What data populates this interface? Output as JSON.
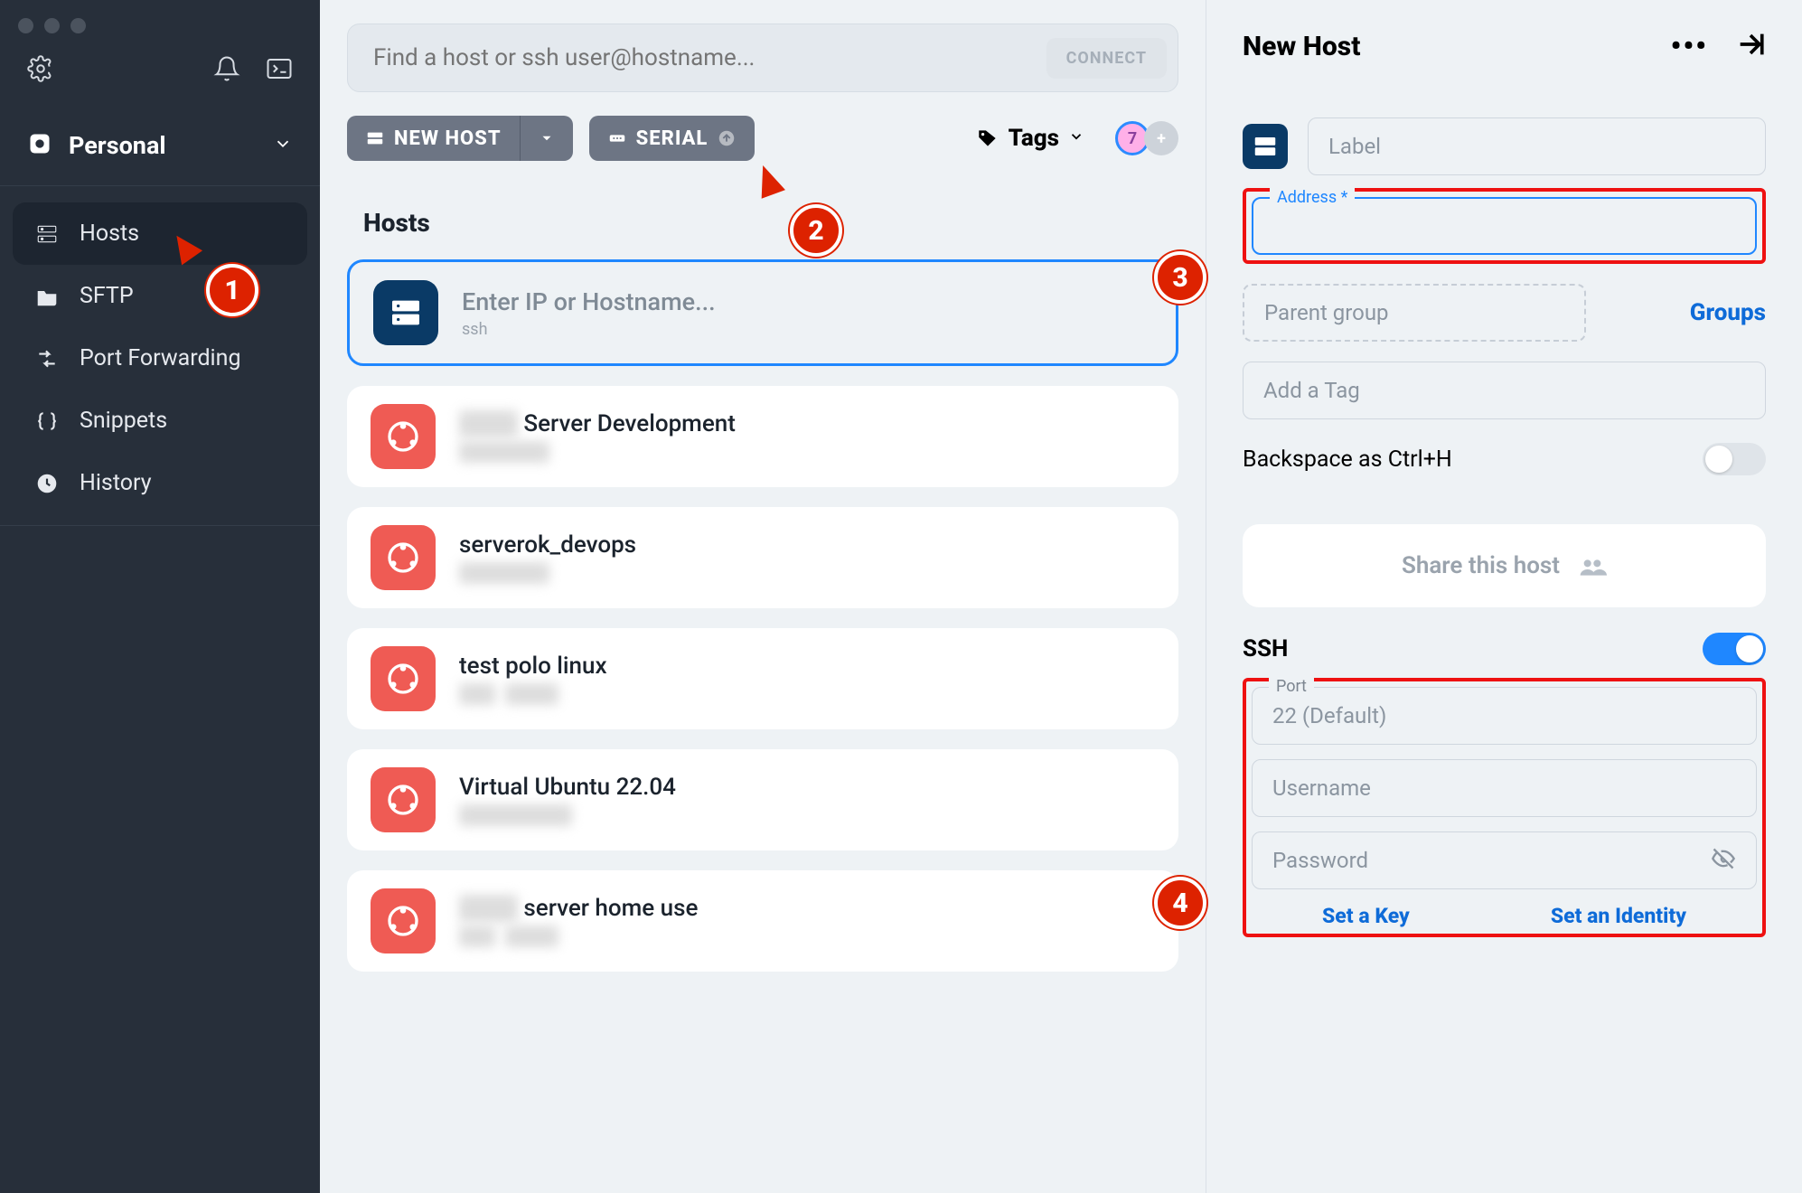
{
  "sidebar": {
    "workspace_label": "Personal",
    "items": [
      {
        "label": "Hosts"
      },
      {
        "label": "SFTP"
      },
      {
        "label": "Port Forwarding"
      },
      {
        "label": "Snippets"
      },
      {
        "label": "History"
      }
    ]
  },
  "search": {
    "placeholder": "Find a host or ssh user@hostname...",
    "connect_label": "CONNECT"
  },
  "toolbar": {
    "new_host_label": "NEW HOST",
    "serial_label": "SERIAL",
    "tags_label": "Tags",
    "avatar_badge": "7",
    "avatar_plus": "+"
  },
  "hosts": {
    "section_title": "Hosts",
    "new": {
      "title": "Enter IP or Hostname...",
      "sub": "ssh"
    },
    "list": [
      {
        "title": "Server Development"
      },
      {
        "title": "serverok_devops"
      },
      {
        "title": "test polo linux"
      },
      {
        "title": "Virtual Ubuntu 22.04"
      },
      {
        "title": "server home use"
      }
    ]
  },
  "right": {
    "title": "New Host",
    "label_ph": "Label",
    "address_label": "Address *",
    "parent_group_ph": "Parent group",
    "groups_link": "Groups",
    "tag_ph": "Add a Tag",
    "backspace_label": "Backspace as Ctrl+H",
    "share_label": "Share this host",
    "ssh_label": "SSH",
    "port_label": "Port",
    "port_ph": "22 (Default)",
    "username_ph": "Username",
    "password_ph": "Password",
    "set_key": "Set a Key",
    "set_identity": "Set an Identity"
  },
  "callouts": {
    "one": "1",
    "two": "2",
    "three": "3",
    "four": "4"
  }
}
